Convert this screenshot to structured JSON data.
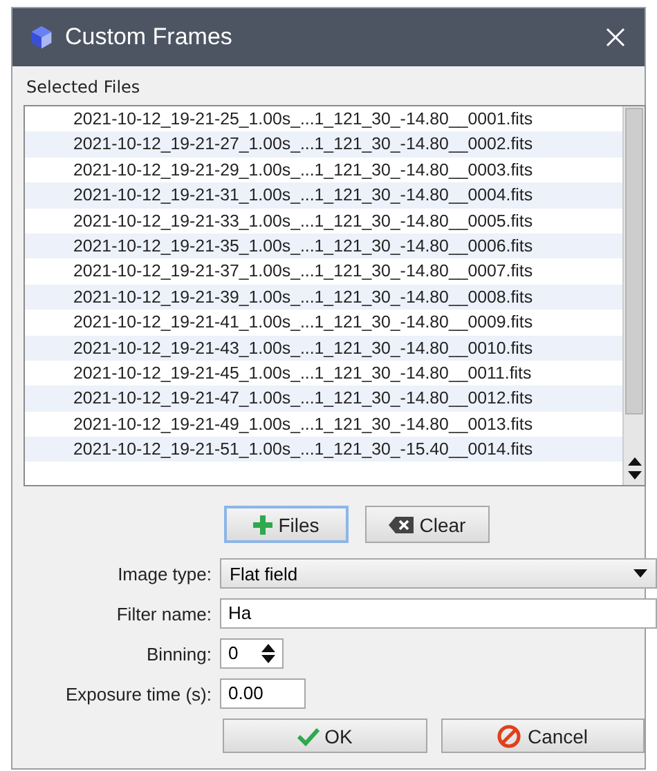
{
  "window": {
    "title": "Custom Frames"
  },
  "selected_files": {
    "label": "Selected Files",
    "files": [
      "2021-10-12_19-21-25_1.00s_...1_121_30_-14.80__0001.fits",
      "2021-10-12_19-21-27_1.00s_...1_121_30_-14.80__0002.fits",
      "2021-10-12_19-21-29_1.00s_...1_121_30_-14.80__0003.fits",
      "2021-10-12_19-21-31_1.00s_...1_121_30_-14.80__0004.fits",
      "2021-10-12_19-21-33_1.00s_...1_121_30_-14.80__0005.fits",
      "2021-10-12_19-21-35_1.00s_...1_121_30_-14.80__0006.fits",
      "2021-10-12_19-21-37_1.00s_...1_121_30_-14.80__0007.fits",
      "2021-10-12_19-21-39_1.00s_...1_121_30_-14.80__0008.fits",
      "2021-10-12_19-21-41_1.00s_...1_121_30_-14.80__0009.fits",
      "2021-10-12_19-21-43_1.00s_...1_121_30_-14.80__0010.fits",
      "2021-10-12_19-21-45_1.00s_...1_121_30_-14.80__0011.fits",
      "2021-10-12_19-21-47_1.00s_...1_121_30_-14.80__0012.fits",
      "2021-10-12_19-21-49_1.00s_...1_121_30_-14.80__0013.fits",
      "2021-10-12_19-21-51_1.00s_...1_121_30_-15.40__0014.fits"
    ]
  },
  "file_buttons": [
    {
      "kind": "add",
      "label": "Files",
      "focused": true
    },
    {
      "kind": "clear",
      "label": "Clear",
      "focused": false
    }
  ],
  "form": [
    {
      "kind": "dropdown",
      "label": "Image type:",
      "value": "Flat field"
    },
    {
      "kind": "text",
      "label": "Filter name:",
      "value": "Ha"
    },
    {
      "kind": "spinner",
      "label": "Binning:",
      "value": "0"
    },
    {
      "kind": "short",
      "label": "Exposure time (s):",
      "value": "0.00"
    }
  ],
  "dialog_buttons": [
    {
      "kind": "ok",
      "label": "OK"
    },
    {
      "kind": "cancel",
      "label": "Cancel"
    }
  ]
}
